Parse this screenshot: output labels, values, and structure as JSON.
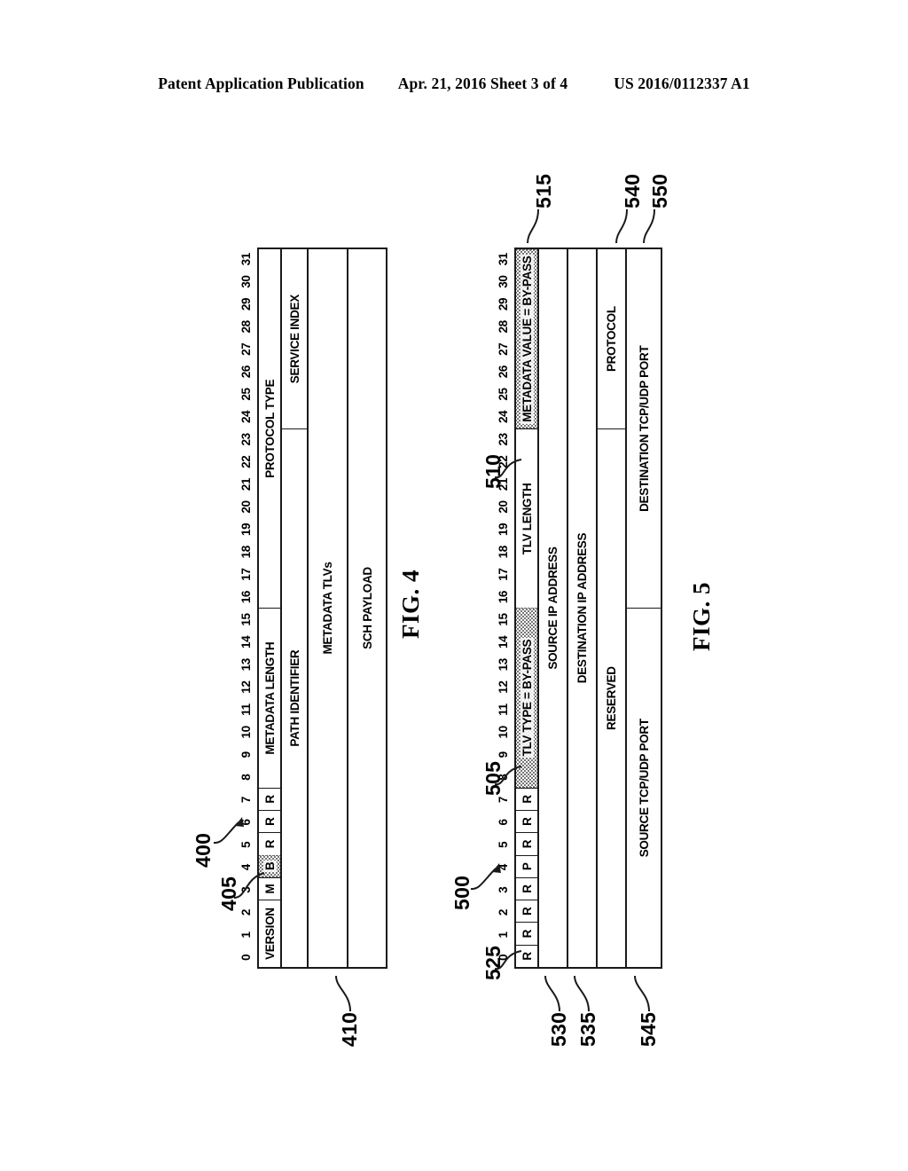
{
  "header": {
    "publication": "Patent Application Publication",
    "date_sheet": "Apr. 21, 2016  Sheet 3 of 4",
    "pub_number": "US 2016/0112337 A1"
  },
  "bit_ruler": [
    "0",
    "1",
    "2",
    "3",
    "4",
    "5",
    "6",
    "7",
    "8",
    "9",
    "10",
    "11",
    "12",
    "13",
    "14",
    "15",
    "16",
    "17",
    "18",
    "19",
    "20",
    "21",
    "22",
    "23",
    "24",
    "25",
    "26",
    "27",
    "28",
    "29",
    "30",
    "31"
  ],
  "fig4": {
    "caption": "FIG. 4",
    "refs": {
      "packet": "400",
      "bypass_bit": "405",
      "payload": "410"
    },
    "rows": [
      {
        "name": "header-row-1",
        "cells": [
          {
            "label": "VERSION",
            "bits": 3,
            "shaded": false
          },
          {
            "label": "M",
            "bits": 1,
            "shaded": false
          },
          {
            "label": "B",
            "bits": 1,
            "shaded": true
          },
          {
            "label": "R",
            "bits": 1,
            "shaded": false
          },
          {
            "label": "R",
            "bits": 1,
            "shaded": false
          },
          {
            "label": "R",
            "bits": 1,
            "shaded": false
          },
          {
            "label": "METADATA LENGTH",
            "bits": 8,
            "shaded": false
          },
          {
            "label": "PROTOCOL TYPE",
            "bits": 16,
            "shaded": false
          }
        ]
      },
      {
        "name": "header-row-2",
        "cells": [
          {
            "label": "PATH IDENTIFIER",
            "bits": 24,
            "shaded": false
          },
          {
            "label": "SERVICE INDEX",
            "bits": 8,
            "shaded": false
          }
        ]
      },
      {
        "name": "metadata-tlvs-row",
        "cells": [
          {
            "label": "METADATA TLVs",
            "bits": 32,
            "shaded": false
          }
        ]
      },
      {
        "name": "sch-payload-row",
        "cells": [
          {
            "label": "SCH PAYLOAD",
            "bits": 32,
            "shaded": false
          }
        ]
      }
    ]
  },
  "fig5": {
    "caption": "FIG. 5",
    "refs": {
      "packet": "500",
      "tlv_type": "505",
      "tlv_length": "510",
      "metadata_value": "515",
      "flag_bits": "525",
      "source_ip": "530",
      "destination_ip": "535",
      "protocol": "540",
      "source_port": "545",
      "destination_port": "550"
    },
    "rows": [
      {
        "name": "tlv-header-row",
        "cells": [
          {
            "label": "R",
            "bits": 1,
            "shaded": false
          },
          {
            "label": "R",
            "bits": 1,
            "shaded": false
          },
          {
            "label": "R",
            "bits": 1,
            "shaded": false
          },
          {
            "label": "R",
            "bits": 1,
            "shaded": false
          },
          {
            "label": "P",
            "bits": 1,
            "shaded": false
          },
          {
            "label": "R",
            "bits": 1,
            "shaded": false
          },
          {
            "label": "R",
            "bits": 1,
            "shaded": false
          },
          {
            "label": "R",
            "bits": 1,
            "shaded": false
          },
          {
            "label": "TLV TYPE = BY-PASS",
            "bits": 8,
            "shaded": true
          },
          {
            "label": "TLV LENGTH",
            "bits": 8,
            "shaded": false
          },
          {
            "label": "METADATA VALUE = BY-PASS",
            "bits": 8,
            "shaded": true
          }
        ]
      },
      {
        "name": "source-ip-row",
        "cells": [
          {
            "label": "SOURCE IP ADDRESS",
            "bits": 32,
            "shaded": false
          }
        ]
      },
      {
        "name": "destination-ip-row",
        "cells": [
          {
            "label": "DESTINATION IP ADDRESS",
            "bits": 32,
            "shaded": false
          }
        ]
      },
      {
        "name": "reserved-protocol-row",
        "cells": [
          {
            "label": "RESERVED",
            "bits": 24,
            "shaded": false
          },
          {
            "label": "PROTOCOL",
            "bits": 8,
            "shaded": false
          }
        ]
      },
      {
        "name": "ports-row",
        "cells": [
          {
            "label": "SOURCE TCP/UDP PORT",
            "bits": 16,
            "shaded": false
          },
          {
            "label": "DESTINATION TCP/UDP PORT",
            "bits": 16,
            "shaded": false
          }
        ]
      }
    ]
  }
}
